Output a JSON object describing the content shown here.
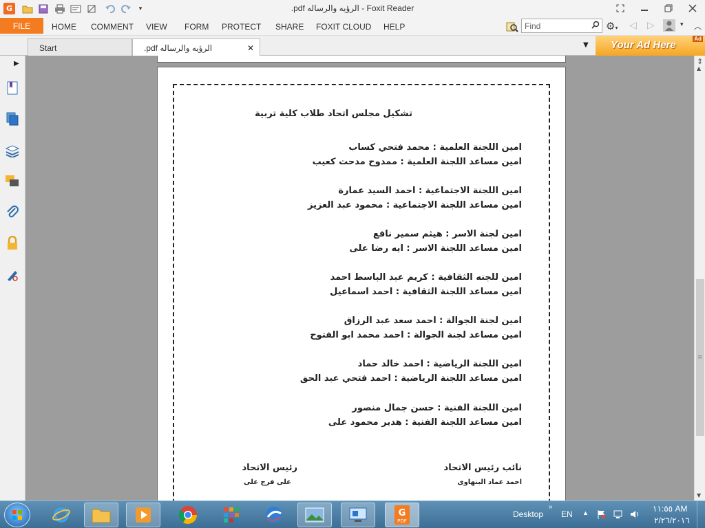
{
  "window": {
    "title": ".pdf الرؤيه والرساله - Foxit Reader",
    "app_logo_letter": "G"
  },
  "menu": {
    "file": "FILE",
    "items": [
      "HOME",
      "COMMENT",
      "VIEW",
      "FORM",
      "PROTECT",
      "SHARE",
      "FOXIT CLOUD",
      "HELP"
    ]
  },
  "search": {
    "placeholder": "Find"
  },
  "tabs": [
    {
      "label": "Start"
    },
    {
      "label": ".pdf الرؤيه والرساله"
    }
  ],
  "ad": {
    "text": "Your Ad Here",
    "tag": "Ad"
  },
  "document": {
    "heading": "تشكيل مجلس اتحاد طلاب كلية تربية",
    "lines": [
      "امين اللجنة العلمية : محمد فتحي كساب",
      "امين مساعد اللجنة العلمية : ممدوح مدحت كعيب",
      "امين اللجنة الاجتماعية : احمد السيد عمارة",
      "امين مساعد اللجنة الاجتماعية : محمود عبد العزيز",
      "امين لجنة الاسر : هيثم سمير نافع",
      "امين مساعد اللجنة الاسر : ايه رضا على",
      "امين للجنه الثقافية : كريم عبد الباسط احمد",
      "امين مساعد اللجنة الثقافية : احمد اسماعيل",
      "امين لجنة الجوالة : احمد سعد عبد الرزاق",
      "امين مساعد لجنة الجوالة : احمد محمد ابو الفتوح",
      "امين اللجنة الرياضية  :  احمد خالد حماد",
      "امين مساعد اللجنة الرياضية : احمد فتحي عبد الحق",
      "امين اللجنة الفنية : حسن جمال منصور",
      "امين مساعد اللجنة الفنية : هدير محمود على"
    ],
    "signatures": {
      "vice_title": "نائب رئيس الاتحاد",
      "vice_name": "احمد عماد البنهاوى",
      "president_title": "رئيس الاتحاد",
      "president_name": "على فرج على"
    }
  },
  "taskbar": {
    "desktop_label": "Desktop",
    "language": "EN",
    "time": "١١:٥٥ AM",
    "date": "٢/٢٦/٢٠١٦"
  }
}
